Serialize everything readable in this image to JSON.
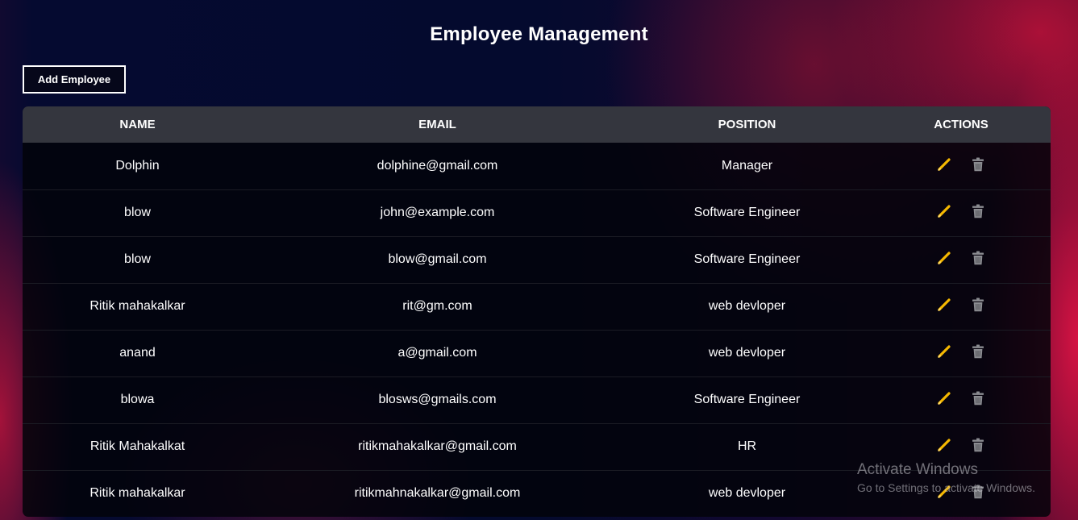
{
  "header": {
    "title": "Employee Management"
  },
  "toolbar": {
    "add_label": "Add Employee"
  },
  "table": {
    "columns": [
      "NAME",
      "EMAIL",
      "POSITION",
      "ACTIONS"
    ],
    "rows": [
      {
        "name": "Dolphin",
        "email": "dolphine@gmail.com",
        "position": "Manager"
      },
      {
        "name": "blow",
        "email": "john@example.com",
        "position": "Software Engineer"
      },
      {
        "name": "blow",
        "email": "blow@gmail.com",
        "position": "Software Engineer"
      },
      {
        "name": "Ritik mahakalkar",
        "email": "rit@gm.com",
        "position": "web devloper"
      },
      {
        "name": "anand",
        "email": "a@gmail.com",
        "position": "web devloper"
      },
      {
        "name": "blowa",
        "email": "blosws@gmails.com",
        "position": "Software Engineer"
      },
      {
        "name": "Ritik Mahakalkat",
        "email": "ritikmahakalkar@gmail.com",
        "position": "HR"
      },
      {
        "name": "Ritik mahakalkar",
        "email": "ritikmahnakalkar@gmail.com",
        "position": "web devloper"
      }
    ],
    "actions": {
      "edit_icon": "pencil-icon",
      "delete_icon": "trash-icon"
    }
  },
  "watermark": {
    "title": "Activate Windows",
    "subtitle": "Go to Settings to activate Windows."
  },
  "colors": {
    "header_row": "#34363e",
    "edit_icon": "#f5b800",
    "delete_icon": "#8a8b90",
    "text": "#ffffff"
  }
}
